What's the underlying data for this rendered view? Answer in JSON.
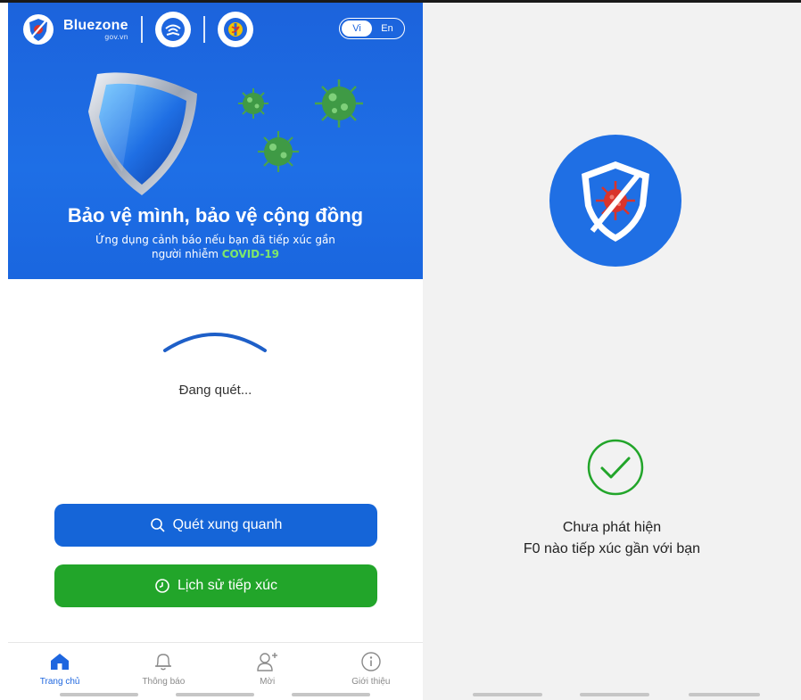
{
  "header": {
    "brand_name": "Bluezone",
    "brand_domain": "gov.vn",
    "lang_vi": "Vi",
    "lang_en": "En",
    "active_lang": "Vi"
  },
  "hero": {
    "title": "Bảo vệ mình, bảo vệ cộng đồng",
    "desc_line1": "Ứng dụng cảnh báo nếu bạn đã tiếp xúc gần",
    "desc_prefix": "người nhiễm ",
    "desc_highlight": "COVID-19"
  },
  "scan": {
    "status": "Đang quét..."
  },
  "buttons": {
    "scan_label": "Quét xung quanh",
    "history_label": "Lịch sử tiếp xúc"
  },
  "tabs": [
    {
      "label": "Trang chủ",
      "icon": "home-icon",
      "active": true
    },
    {
      "label": "Thông báo",
      "icon": "bell-icon",
      "active": false
    },
    {
      "label": "Mời",
      "icon": "add-user-icon",
      "active": false
    },
    {
      "label": "Giới thiệu",
      "icon": "info-icon",
      "active": false
    }
  ],
  "result": {
    "line1": "Chưa phát hiện",
    "line2": "F0 nào tiếp xúc gần với bạn"
  },
  "colors": {
    "primary_blue": "#1e66df",
    "scan_button": "#1565d8",
    "history_button": "#22a52a",
    "check_green": "#22a52a",
    "virus_red": "#d9342b",
    "covid_highlight": "#7ee86a"
  }
}
